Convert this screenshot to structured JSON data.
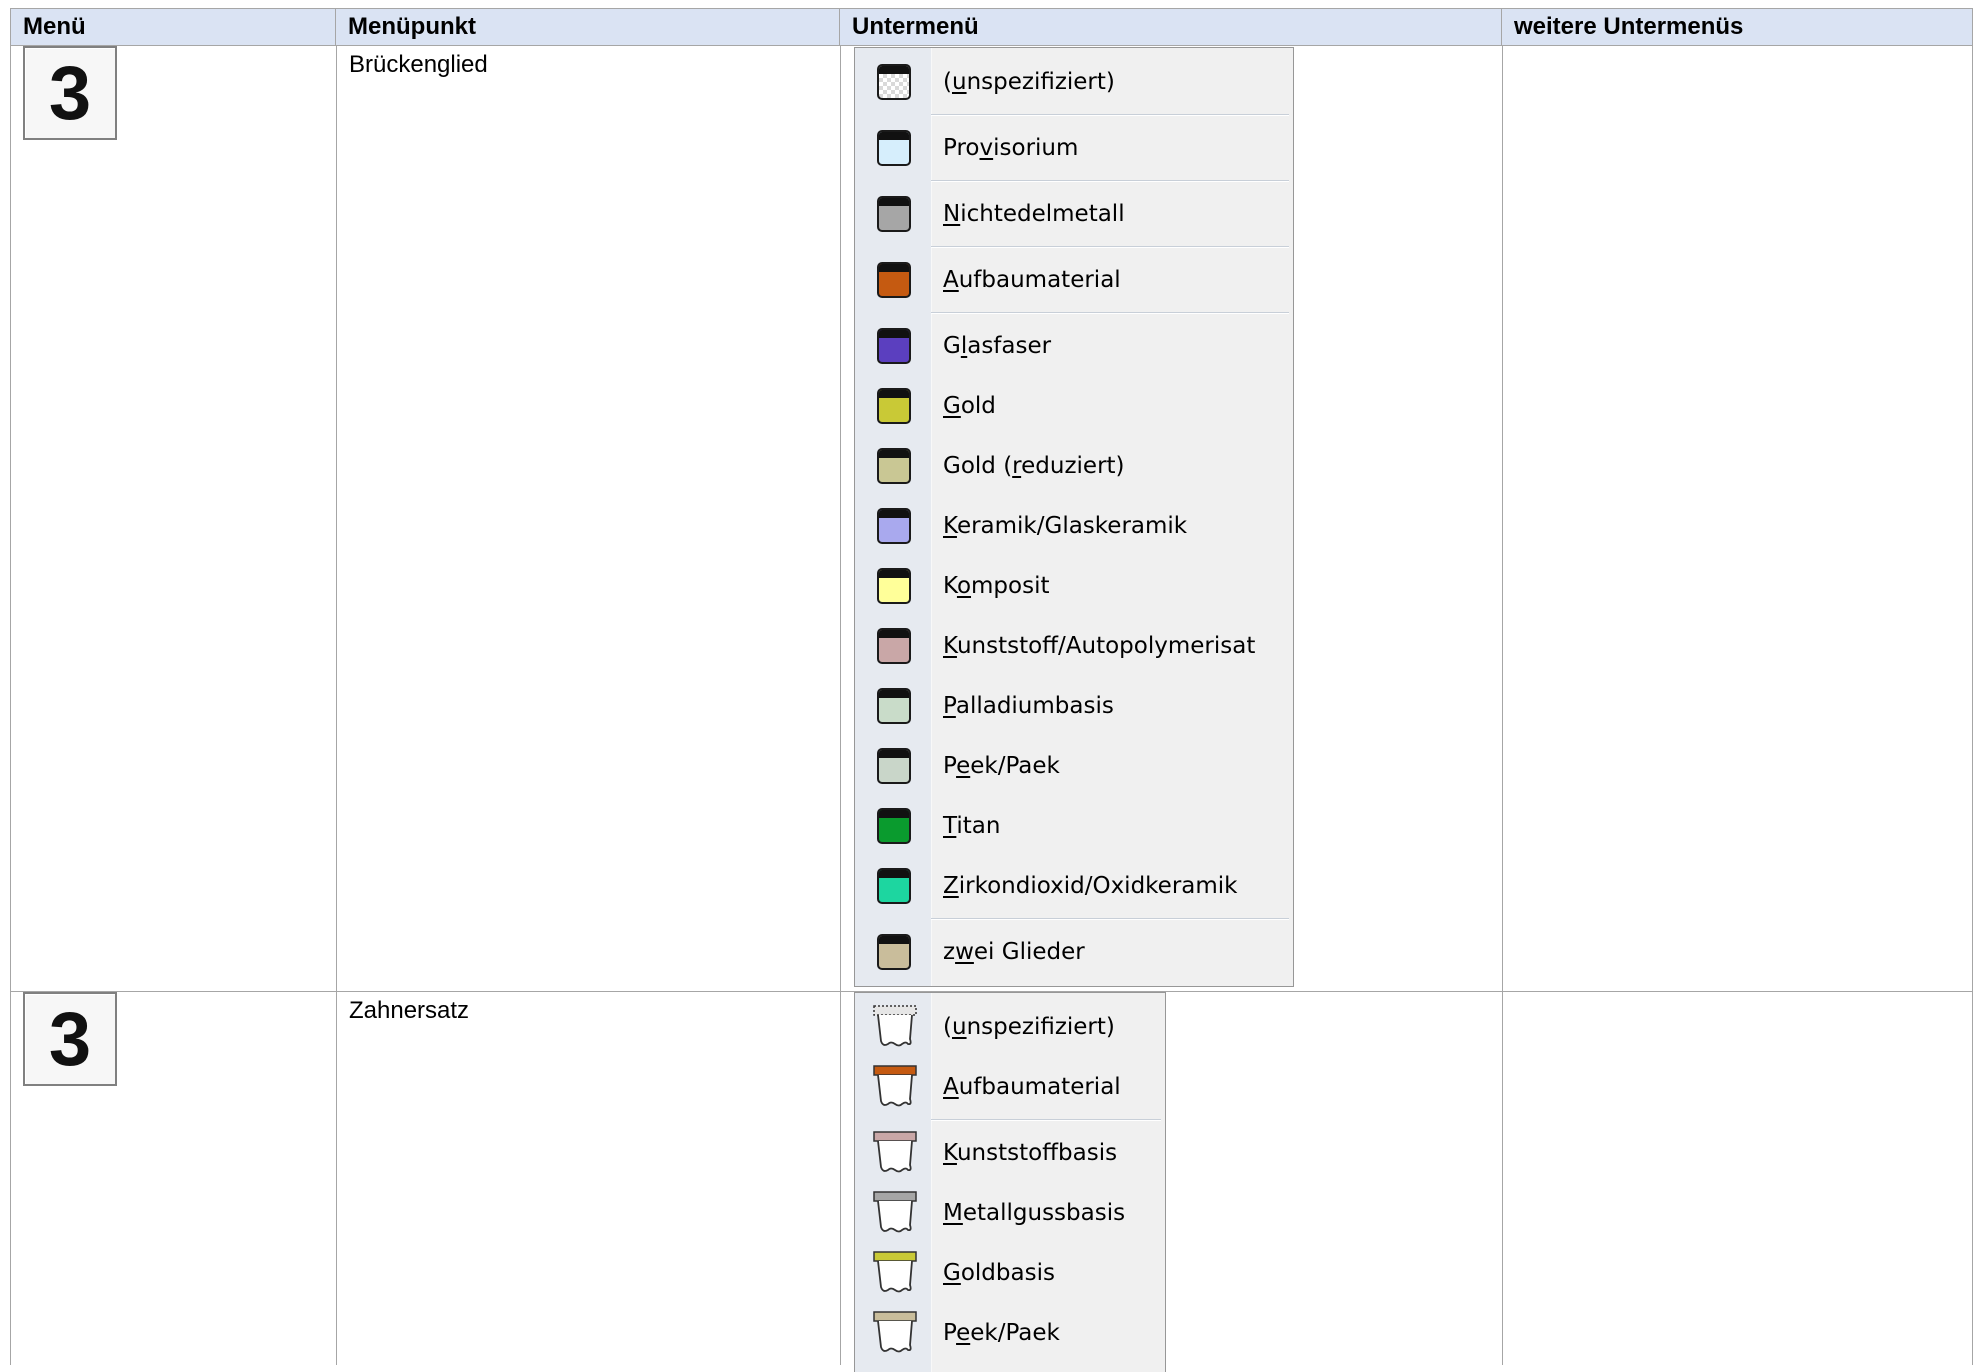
{
  "table": {
    "headers": [
      "Menü",
      "Menüpunkt",
      "Untermenü",
      "weitere Untermenüs"
    ],
    "rows": [
      {
        "menu_icon_text": "3",
        "menupunkt": "Brückenglied",
        "submenu": [
          {
            "label": "(unspezifiziert)",
            "u": "u",
            "color": "checker",
            "sep_after": true
          },
          {
            "label": "Provisorium",
            "u": "v",
            "color": "#d6eefc",
            "sep_after": true
          },
          {
            "label": "Nichtedelmetall",
            "u": "N",
            "color": "#a6a6a6",
            "sep_after": true
          },
          {
            "label": "Aufbaumaterial",
            "u": "A",
            "color": "#c55a11",
            "sep_after": true
          },
          {
            "label": "Glasfaser",
            "u": "l",
            "color": "#5b3fbf"
          },
          {
            "label": "Gold",
            "u": "G",
            "color": "#c9c936"
          },
          {
            "label": "Gold (reduziert)",
            "u": "r",
            "color": "#c9c794"
          },
          {
            "label": "Keramik/Glaskeramik",
            "u": "K",
            "color": "#a9a9ee"
          },
          {
            "label": "Komposit",
            "u": "o",
            "color": "#ffff99"
          },
          {
            "label": "Kunststoff/Autopolymerisat",
            "u": "K",
            "color": "#c9a7a7"
          },
          {
            "label": "Palladiumbasis",
            "u": "P",
            "color": "#c9dcc9"
          },
          {
            "label": "Peek/Paek",
            "u": "e",
            "color": "#c9d6c9"
          },
          {
            "label": "Titan",
            "u": "T",
            "color": "#0a9b2e"
          },
          {
            "label": "Zirkondioxid/Oxidkeramik",
            "u": "Z",
            "color": "#1dd6a0",
            "sep_after": true
          },
          {
            "label": "zwei Glieder",
            "u": "w",
            "color": "#c9bd9b"
          }
        ]
      },
      {
        "menu_icon_text": "3",
        "menupunkt": "Zahnersatz",
        "submenu": [
          {
            "label": "(unspezifiziert)",
            "u": "u",
            "color": "checker"
          },
          {
            "label": "Aufbaumaterial",
            "u": "A",
            "color": "#c55a11",
            "sep_after": true
          },
          {
            "label": "Kunststoffbasis",
            "u": "K",
            "color": "#c9a7a7"
          },
          {
            "label": "Metallgussbasis",
            "u": "M",
            "color": "#a6a6a6"
          },
          {
            "label": "Goldbasis",
            "u": "G",
            "color": "#c9c936"
          },
          {
            "label": "Peek/Paek",
            "u": "e",
            "color": "#c9bd9b"
          }
        ]
      }
    ]
  }
}
